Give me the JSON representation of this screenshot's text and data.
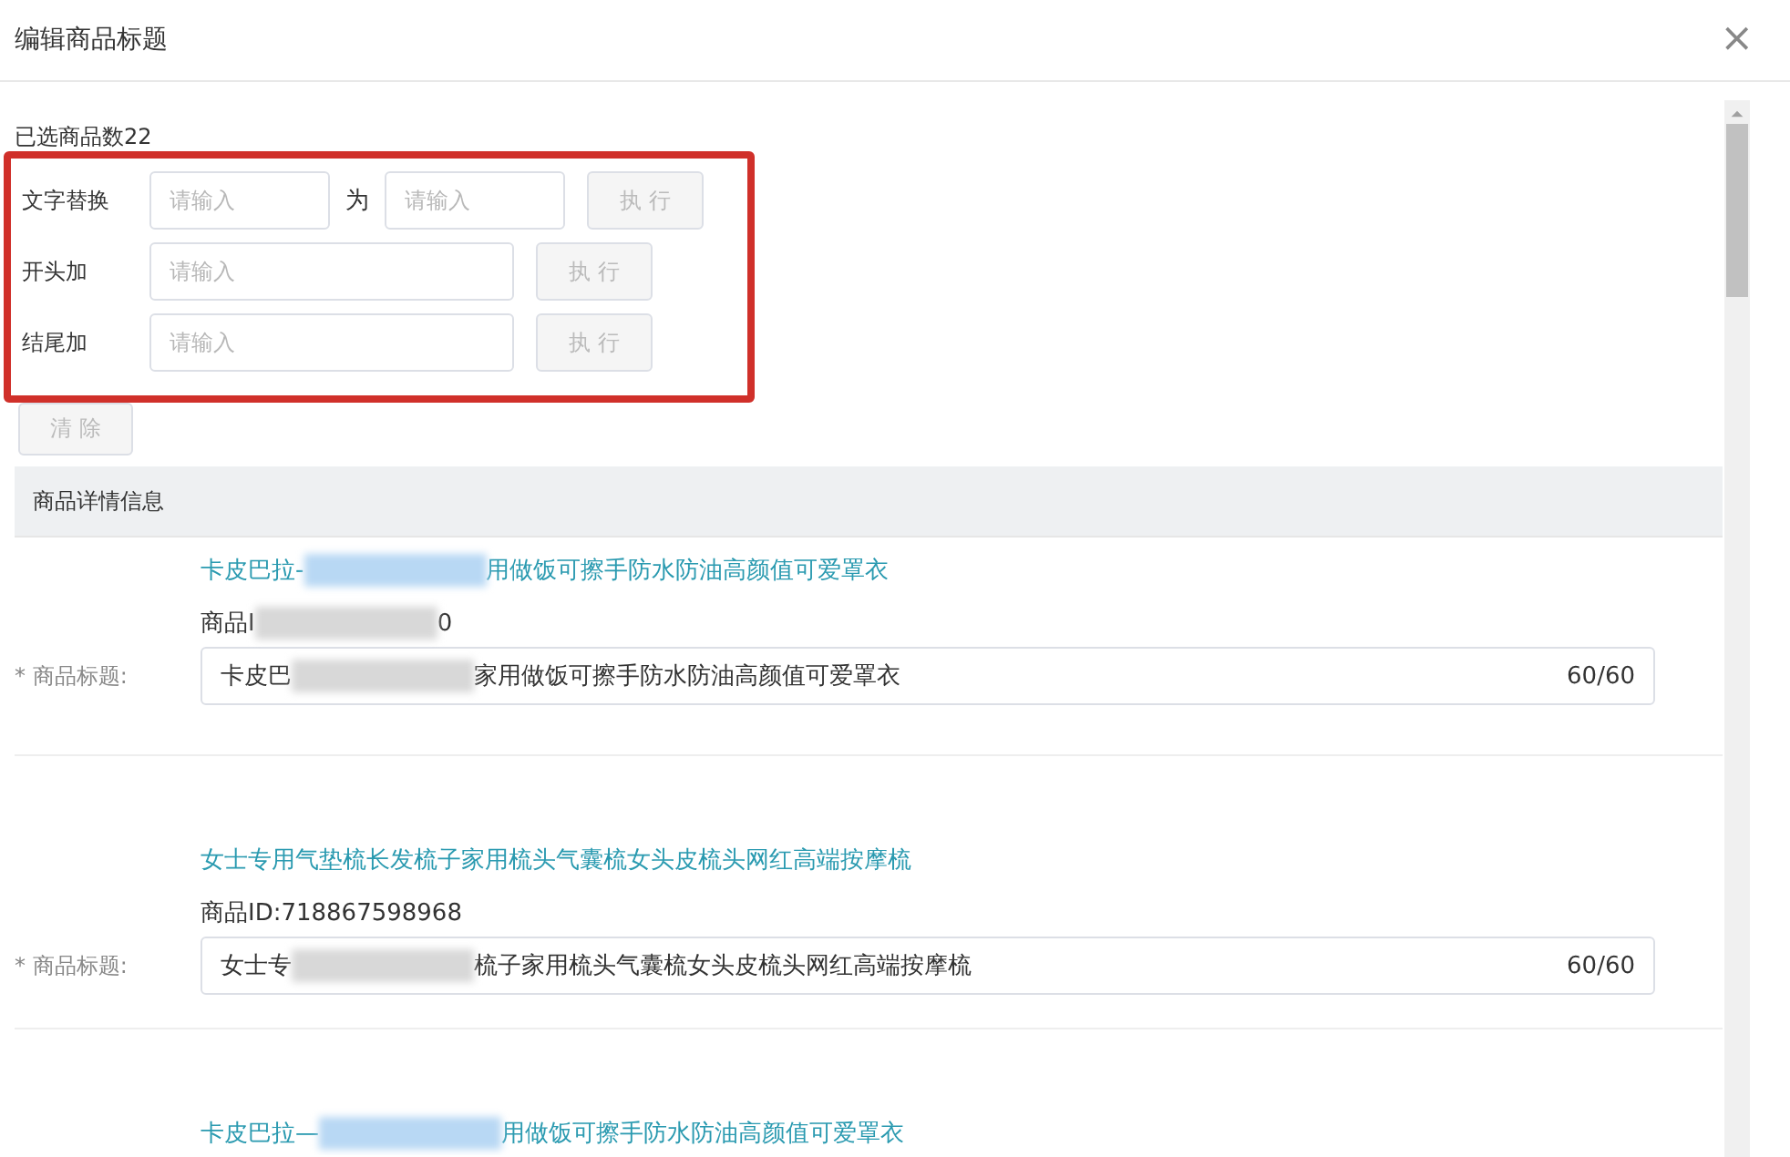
{
  "dialog": {
    "title": "编辑商品标题",
    "close": "×"
  },
  "selected_count": "已选商品数22",
  "bulk_edit": {
    "highlighted": true,
    "rows": [
      {
        "kind": "replace",
        "label": "文字替换",
        "placeholder": "请输入",
        "joiner": "为",
        "placeholder_2": "请输入",
        "button": "执 行",
        "disabled": true
      },
      {
        "kind": "single",
        "label": "开头加",
        "placeholder": "请输入",
        "button": "执 行",
        "disabled": true
      },
      {
        "kind": "single",
        "label": "结尾加",
        "placeholder": "请输入",
        "button": "执 行",
        "disabled": true
      }
    ],
    "clear_button": {
      "label": "清 除",
      "disabled": true
    }
  },
  "section_header": "商品详情信息",
  "products": [
    {
      "link": {
        "before": "卡皮巴拉-",
        "redacted": true,
        "after": "用做饭可擦手防水防油高颜值可爱罩衣"
      },
      "id": {
        "before": "商品I",
        "redacted": true,
        "after": "0"
      },
      "field_label": "* 商品标题:",
      "value": {
        "before": "卡皮巴",
        "redacted": true,
        "after": "家用做饭可擦手防水防油高颜值可爱罩衣"
      },
      "count": "60/60"
    },
    {
      "link": {
        "before": "女士专用气垫梳长发梳子家用梳头气囊梳女头皮梳头网红高端按摩梳",
        "redacted": false
      },
      "id": {
        "before": "商品ID:718867598968",
        "redacted": false
      },
      "field_label": "* 商品标题:",
      "value": {
        "before": "女士专",
        "redacted": true,
        "after": "梳子家用梳头气囊梳女头皮梳头网红高端按摩梳"
      },
      "count": "60/60"
    },
    {
      "link": {
        "before": "卡皮巴拉—",
        "redacted": true,
        "after": "用做饭可擦手防水防油高颜值可爱罩衣"
      }
    }
  ]
}
